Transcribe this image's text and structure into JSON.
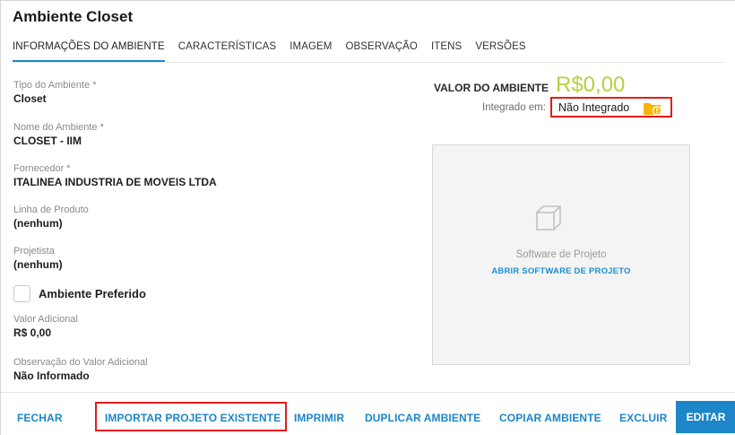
{
  "page": {
    "title": "Ambiente Closet"
  },
  "tabs": [
    {
      "label": "INFORMAÇÕES DO AMBIENTE",
      "active": true
    },
    {
      "label": "CARACTERÍSTICAS",
      "active": false
    },
    {
      "label": "IMAGEM",
      "active": false
    },
    {
      "label": "OBSERVAÇÃO",
      "active": false
    },
    {
      "label": "ITENS",
      "active": false
    },
    {
      "label": "VERSÕES",
      "active": false
    }
  ],
  "fields": {
    "tipo": {
      "label": "Tipo do Ambiente *",
      "value": "Closet"
    },
    "nome": {
      "label": "Nome do Ambiente *",
      "value": "CLOSET - IIM"
    },
    "fornecedor": {
      "label": "Fornecedor *",
      "value": "ITALINEA INDUSTRIA DE MOVEIS LTDA"
    },
    "linha": {
      "label": "Linha de Produto",
      "value": "(nenhum)"
    },
    "projetista": {
      "label": "Projetista",
      "value": "(nenhum)"
    },
    "valor_adicional": {
      "label": "Valor Adicional",
      "value": "R$ 0,00"
    },
    "observacao_valor": {
      "label": "Observação do Valor Adicional",
      "value": "Não Informado"
    }
  },
  "preferido": {
    "label": "Ambiente Preferido",
    "checked": false
  },
  "valor": {
    "label": "VALOR DO AMBIENTE",
    "amount": "R$0,00",
    "color": "#b8cf41"
  },
  "integracao": {
    "label": "Integrado em:",
    "value": "Não Integrado",
    "icon": "folder-warning-icon"
  },
  "software": {
    "label": "Software de Projeto",
    "link": "ABRIR SOFTWARE DE PROJETO",
    "icon": "cube-icon"
  },
  "footer": {
    "fechar": "FECHAR",
    "importar": "IMPORTAR PROJETO EXISTENTE",
    "imprimir": "IMPRIMIR",
    "duplicar": "DUPLICAR AMBIENTE",
    "copiar": "COPIAR AMBIENTE",
    "excluir": "EXCLUIR",
    "editar": "EDITAR"
  },
  "colors": {
    "accent": "#1d86c8",
    "highlight": "#e41b1b",
    "value": "#b8cf41"
  }
}
